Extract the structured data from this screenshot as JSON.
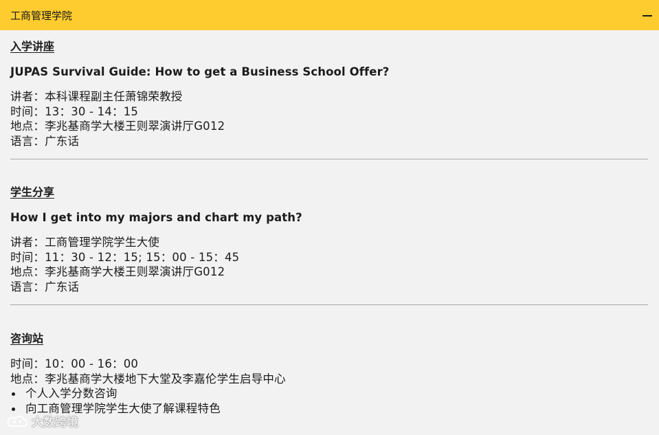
{
  "header": {
    "title": "工商管理学院"
  },
  "sections": [
    {
      "title": "入学讲座",
      "talk_title": "JUPAS Survival Guide: How to get a Business School Offer?",
      "speaker": "讲者：本科课程副主任萧锦荣教授",
      "time": "时间：13：30 - 14：15",
      "location": "地点：李兆基商学大楼王则翠演讲厅G012",
      "language": "语言：广东话"
    },
    {
      "title": "学生分享",
      "talk_title": "How I get into my majors and chart my path?",
      "speaker": "讲者：工商管理学院学生大使",
      "time": "时间：11：30 - 12：15; 15：00 - 15：45",
      "location": "地点：李兆基商学大楼王则翠演讲厅G012",
      "language": "语言：广东话"
    },
    {
      "title": "咨询站",
      "time": "时间：10：00 - 16：00",
      "location": "地点：李兆基商学大楼地下大堂及李嘉伦学生启导中心",
      "bullets": [
        "个人入学分数咨询",
        "向工商管理学院学生大使了解课程特色"
      ]
    }
  ],
  "watermark": {
    "text": "大数跨境"
  },
  "colors": {
    "header_bg": "#fecc2f",
    "page_bg": "#f2f2f2",
    "divider": "#a9a9a9"
  },
  "icons": {
    "collapse": "minus-icon",
    "watermark": "logo-icon"
  }
}
